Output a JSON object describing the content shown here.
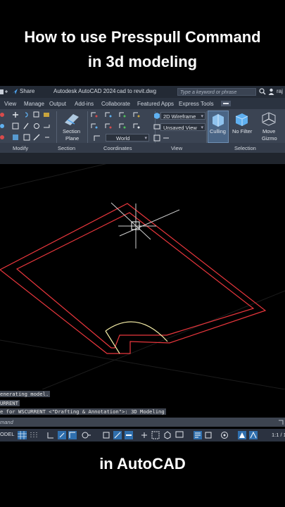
{
  "captions": {
    "line1": "How to use Presspull Command",
    "line2": "in 3d modeling",
    "bottom": "in AutoCAD"
  },
  "titlebar": {
    "share": "Share",
    "app": "Autodesk AutoCAD 2024",
    "file": "cad to revit.dwg",
    "search_placeholder": "Type a keyword or phrase",
    "user": "raj"
  },
  "ribbon_tabs": [
    "View",
    "Manage",
    "Output",
    "Add-ins",
    "Collaborate",
    "Featured Apps",
    "Express Tools"
  ],
  "ribbon": {
    "section_plane": [
      "Section",
      "Plane"
    ],
    "visual_style": "2D Wireframe",
    "view_name": "Unsaved View",
    "ucs": "World",
    "culling": "Culling",
    "no_filter": "No Filter",
    "move_gizmo": [
      "Move",
      "Gizmo"
    ],
    "panels": [
      "Modify",
      "Section",
      "Coordinates",
      "View",
      "Selection"
    ]
  },
  "command_history": [
    "enerating model.",
    "URRENT",
    "e for WSCURRENT <\"Drafting & Annotation\">: 3D Modeling"
  ],
  "command_prompt": "mand",
  "status_bar": {
    "model": "ODEL",
    "scale": "1:1 / 1"
  },
  "colors": {
    "wall": "#e8363c",
    "door": "#f2eaa5",
    "accent": "#3b8fd9"
  }
}
